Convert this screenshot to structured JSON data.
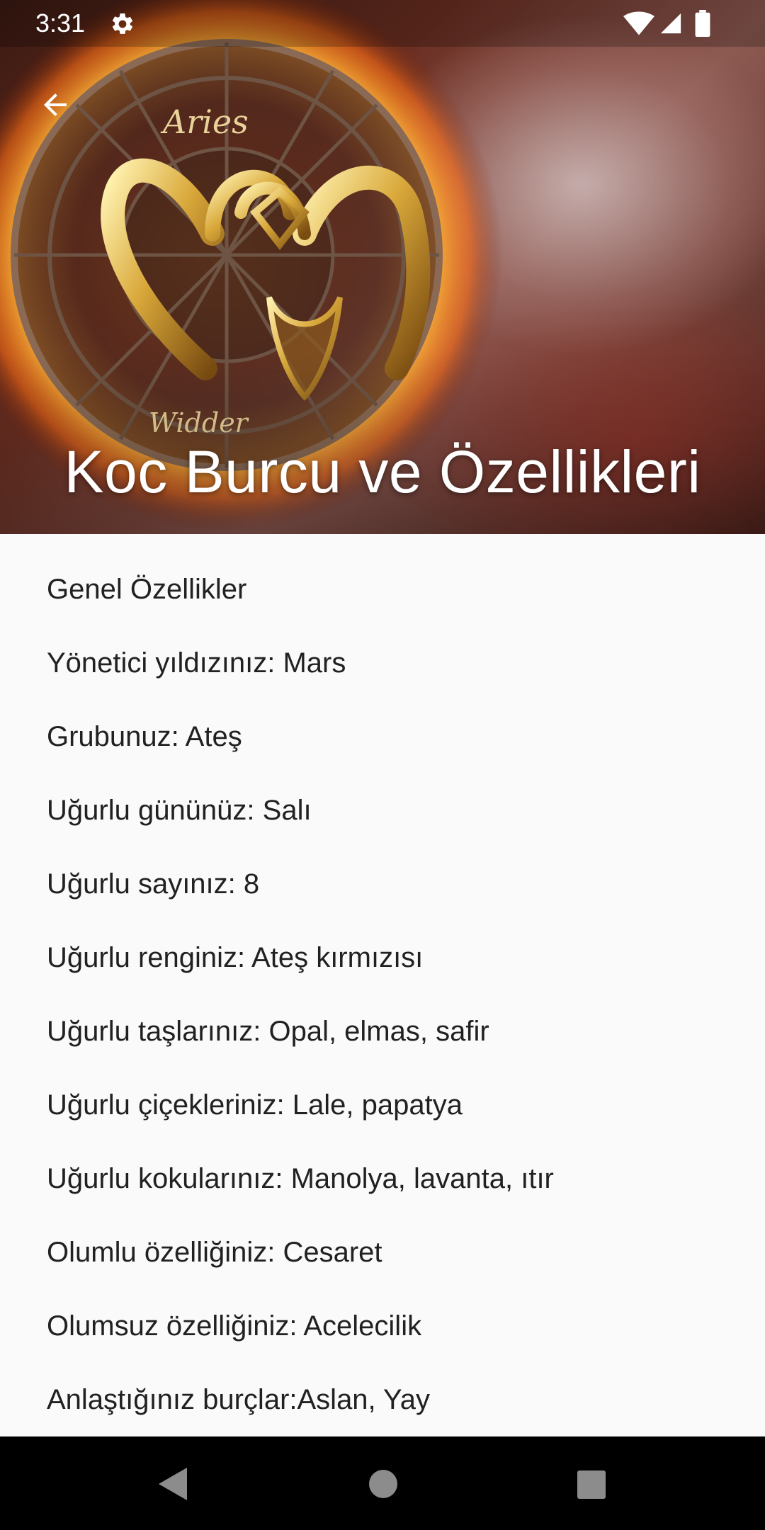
{
  "status_bar": {
    "time": "3:31",
    "icons": [
      "gear-icon",
      "wifi-icon",
      "signal-icon",
      "battery-icon"
    ]
  },
  "header": {
    "back_icon": "arrow-back-icon",
    "title": "Koc Burcu ve Özellikleri",
    "image_lettering": [
      "Aries",
      "Widder"
    ],
    "title_color": "#ffffff"
  },
  "features": [
    {
      "text": "Genel Özellikler"
    },
    {
      "text": "Yönetici yıldızınız: Mars"
    },
    {
      "text": "Grubunuz: Ateş"
    },
    {
      "text": "Uğurlu gününüz: Salı"
    },
    {
      "text": "Uğurlu sayınız: 8"
    },
    {
      "text": "Uğurlu renginiz: Ateş kırmızısı"
    },
    {
      "text": "Uğurlu taşlarınız: Opal, elmas, safir"
    },
    {
      "text": "Uğurlu çiçekleriniz: Lale, papatya"
    },
    {
      "text": "Uğurlu kokularınız: Manolya, lavanta, ıtır"
    },
    {
      "text": "Olumlu özelliğiniz: Cesaret"
    },
    {
      "text": "Olumsuz özelliğiniz: Acelecilik"
    },
    {
      "text": "Anlaştığınız burçlar:Aslan, Yay"
    }
  ],
  "nav_bar": {
    "icons": [
      "nav-back-icon",
      "nav-home-icon",
      "nav-recents-icon"
    ]
  },
  "colors": {
    "text": "#212121",
    "background": "#fafafa",
    "nav_bar": "#000000"
  }
}
